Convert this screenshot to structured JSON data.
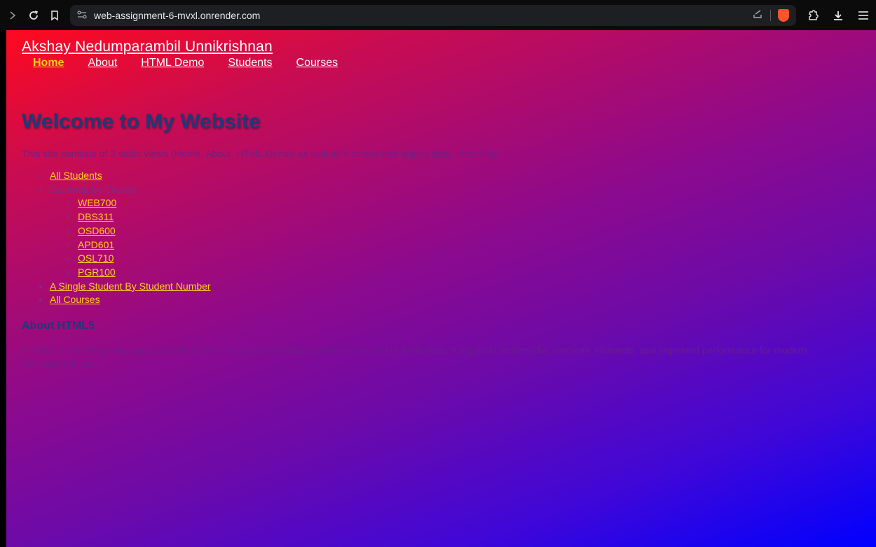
{
  "browser": {
    "url": "web-assignment-6-mvxl.onrender.com",
    "icons": [
      "forward-icon",
      "reload-icon",
      "bookmark-icon",
      "site-info-icon",
      "share-icon",
      "brave-shield-icon",
      "extensions-icon",
      "download-icon",
      "menu-icon"
    ]
  },
  "site": {
    "title": "Akshay Nedumparambil Unnikrishnan",
    "nav": [
      "Home",
      "About",
      "HTML Demo",
      "Students",
      "Courses"
    ],
    "active_nav": "Home"
  },
  "main": {
    "heading": "Welcome to My Website",
    "intro": "This site consists of 3 static views (Home, About, HTML Demo) as well as 5 routes that supply data, including:",
    "routes": {
      "all_students": "All Students",
      "students_by_course": "Students by Course:",
      "courses": [
        "WEB700",
        "DBS311",
        "OSD600",
        "APD601",
        "OSL710",
        "PGR100"
      ],
      "single_student": "A Single Student By Student Number",
      "all_courses": "All Courses"
    },
    "about_heading": "About HTML5",
    "about_text": "HTML5 is a markup language used for structuring and presenting content on the World Wide Web. It supports multimedia, semantic elements, and improved performance for modern web applications."
  },
  "colors": {
    "link": "#ffcf1f",
    "heading": "#1c3a7a",
    "gradient_start": "#ff0a1e",
    "gradient_end": "#0000ff"
  }
}
